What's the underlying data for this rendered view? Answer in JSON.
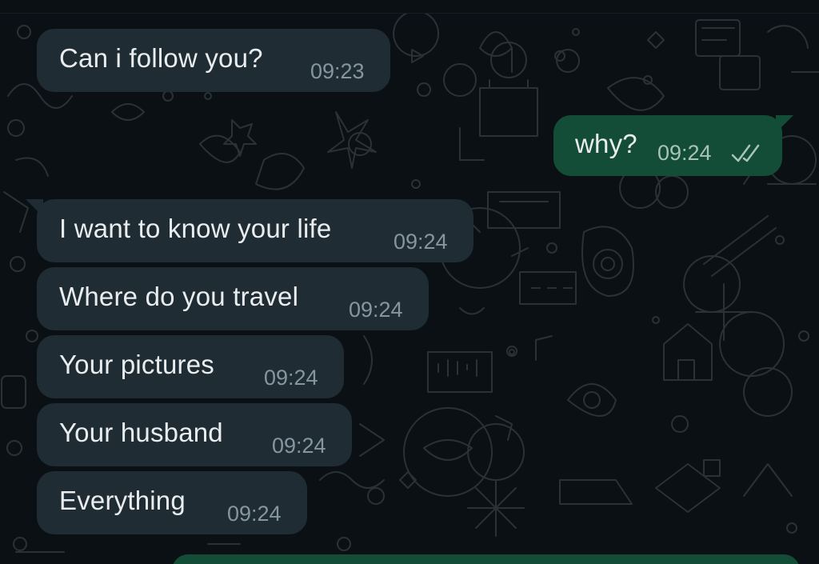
{
  "colors": {
    "background": "#0b1014",
    "incoming_bubble": "#1f2c33",
    "outgoing_bubble": "#144d37",
    "text": "#e9edef",
    "timestamp": "#8696a0",
    "read_ticks": "#a8c3b8"
  },
  "messages": [
    {
      "direction": "incoming",
      "text": "Can i follow you?",
      "time": "09:23"
    },
    {
      "direction": "outgoing",
      "text": "why?",
      "time": "09:24",
      "status_icon": "double-check-read-icon"
    },
    {
      "direction": "incoming",
      "text": "I want to know your life",
      "time": "09:24"
    },
    {
      "direction": "incoming",
      "text": "Where do you travel",
      "time": "09:24"
    },
    {
      "direction": "incoming",
      "text": "Your pictures",
      "time": "09:24"
    },
    {
      "direction": "incoming",
      "text": "Your husband",
      "time": "09:24"
    },
    {
      "direction": "incoming",
      "text": "Everything",
      "time": "09:24"
    }
  ]
}
